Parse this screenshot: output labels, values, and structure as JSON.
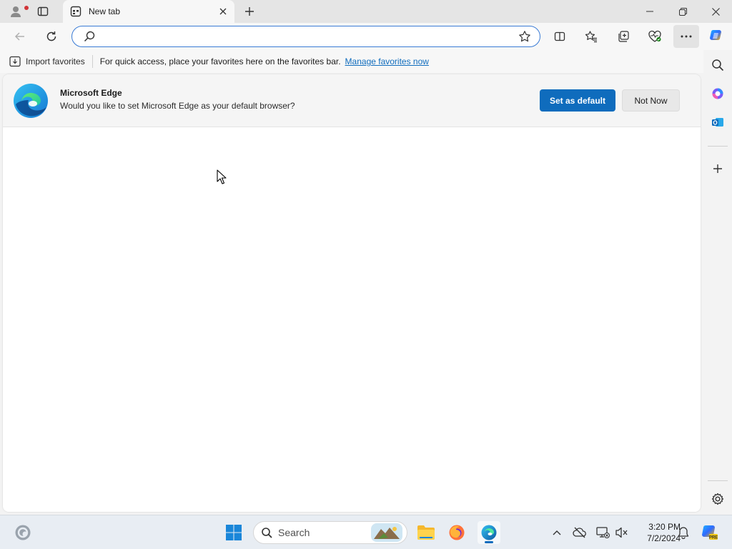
{
  "tab": {
    "title": "New tab"
  },
  "addressbar": {
    "value": "",
    "placeholder": ""
  },
  "favorites_bar": {
    "import_label": "Import favorites",
    "message": "For quick access, place your favorites here on the favorites bar.",
    "manage_link": "Manage favorites now"
  },
  "banner": {
    "title": "Microsoft Edge",
    "subtitle": "Would you like to set Microsoft Edge as your default browser?",
    "primary_button": "Set as default",
    "secondary_button": "Not Now"
  },
  "taskbar": {
    "search_label": "Search",
    "time": "3:20 PM",
    "date": "7/2/2024"
  },
  "colors": {
    "accent": "#0f6cbd",
    "titlebar": "#e5e5e5",
    "toolbar": "#f7f7f7",
    "taskbar": "#e8edf3"
  },
  "icons": [
    "profile-icon",
    "tab-actions-icon",
    "new-tab-page-icon",
    "close-icon",
    "plus-icon",
    "minimize-icon",
    "restore-icon",
    "back-icon",
    "refresh-icon",
    "search-icon",
    "star-icon",
    "split-screen-icon",
    "favorites-icon",
    "collections-icon",
    "browser-essentials-icon",
    "more-icon",
    "copilot-icon",
    "import-icon",
    "edge-logo-icon",
    "office-icon",
    "outlook-icon",
    "settings-icon",
    "windows-start-icon",
    "file-explorer-icon",
    "firefox-icon",
    "edge-icon",
    "chevron-up-icon",
    "onedrive-icon",
    "network-icon",
    "volume-icon",
    "bell-icon"
  ]
}
